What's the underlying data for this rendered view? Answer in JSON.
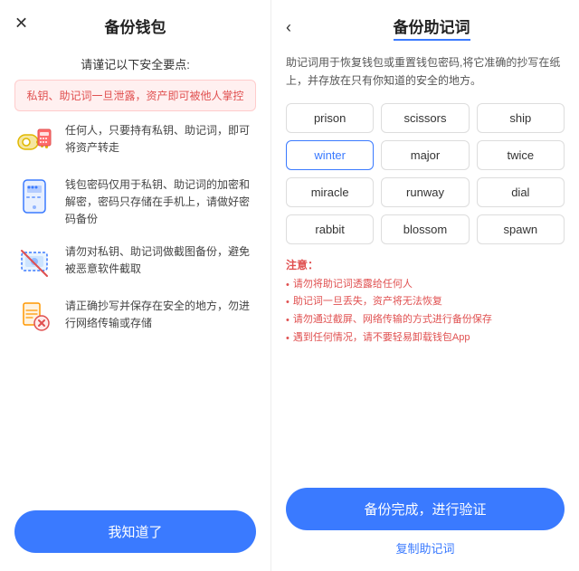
{
  "left": {
    "close_icon": "✕",
    "title": "备份钱包",
    "subtitle": "请谨记以下安全要点:",
    "warning": "私钥、助记词一旦泄露，资产即可被他人掌控",
    "items": [
      {
        "id": "key",
        "text": "任何人，只要持有私钥、助记词，即可将资产转走"
      },
      {
        "id": "phone",
        "text": "钱包密码仅用于私钥、助记词的加密和解密，密码只存储在手机上，请做好密码备份"
      },
      {
        "id": "camera",
        "text": "请勿对私钥、助记词做截图备份，避免被恶意软件截取"
      },
      {
        "id": "safe",
        "text": "请正确抄写并保存在安全的地方，勿进行网络传输或存储"
      }
    ],
    "button": "我知道了"
  },
  "right": {
    "back_icon": "‹",
    "title": "备份助记词",
    "description": "助记词用于恢复钱包或重置钱包密码,将它准确的抄写在纸上，并存放在只有你知道的安全的地方。",
    "words": [
      {
        "word": "prison",
        "highlighted": false
      },
      {
        "word": "scissors",
        "highlighted": false
      },
      {
        "word": "ship",
        "highlighted": false
      },
      {
        "word": "winter",
        "highlighted": true
      },
      {
        "word": "major",
        "highlighted": false
      },
      {
        "word": "twice",
        "highlighted": false
      },
      {
        "word": "miracle",
        "highlighted": false
      },
      {
        "word": "runway",
        "highlighted": false
      },
      {
        "word": "dial",
        "highlighted": false
      },
      {
        "word": "rabbit",
        "highlighted": false
      },
      {
        "word": "blossom",
        "highlighted": false
      },
      {
        "word": "spawn",
        "highlighted": false
      }
    ],
    "notes_title": "注意：",
    "notes": [
      "请勿将助记词透露给任何人",
      "助记词一旦丢失，资产将无法恢复",
      "请勿通过截屏、网络传输的方式进行备份保存",
      "遇到任何情况，请不要轻易卸载钱包App"
    ],
    "button": "备份完成，进行验证",
    "copy_link": "复制助记词"
  }
}
